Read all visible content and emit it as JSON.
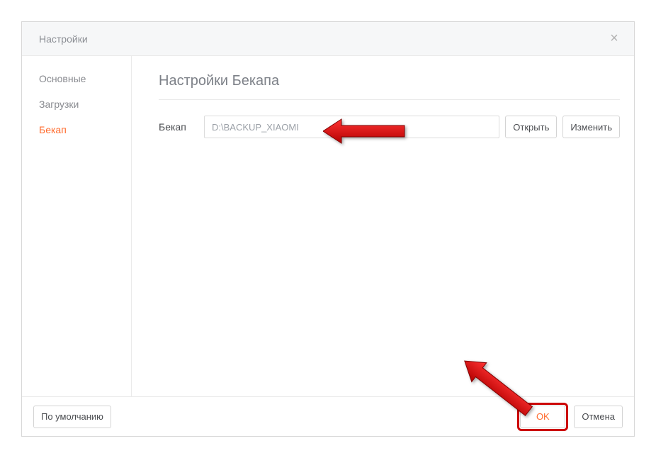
{
  "window": {
    "title": "Настройки",
    "close_glyph": "×"
  },
  "sidebar": {
    "items": [
      {
        "label": "Основные"
      },
      {
        "label": "Загрузки"
      },
      {
        "label": "Бекап"
      }
    ],
    "active_index": 2
  },
  "content": {
    "section_title": "Настройки Бекапа",
    "row_label": "Бекап",
    "path": "D:\\BACKUP_XIAOMI",
    "open_label": "Открыть",
    "change_label": "Изменить"
  },
  "footer": {
    "default_label": "По умолчанию",
    "ok_label": "OK",
    "cancel_label": "Отмена"
  }
}
